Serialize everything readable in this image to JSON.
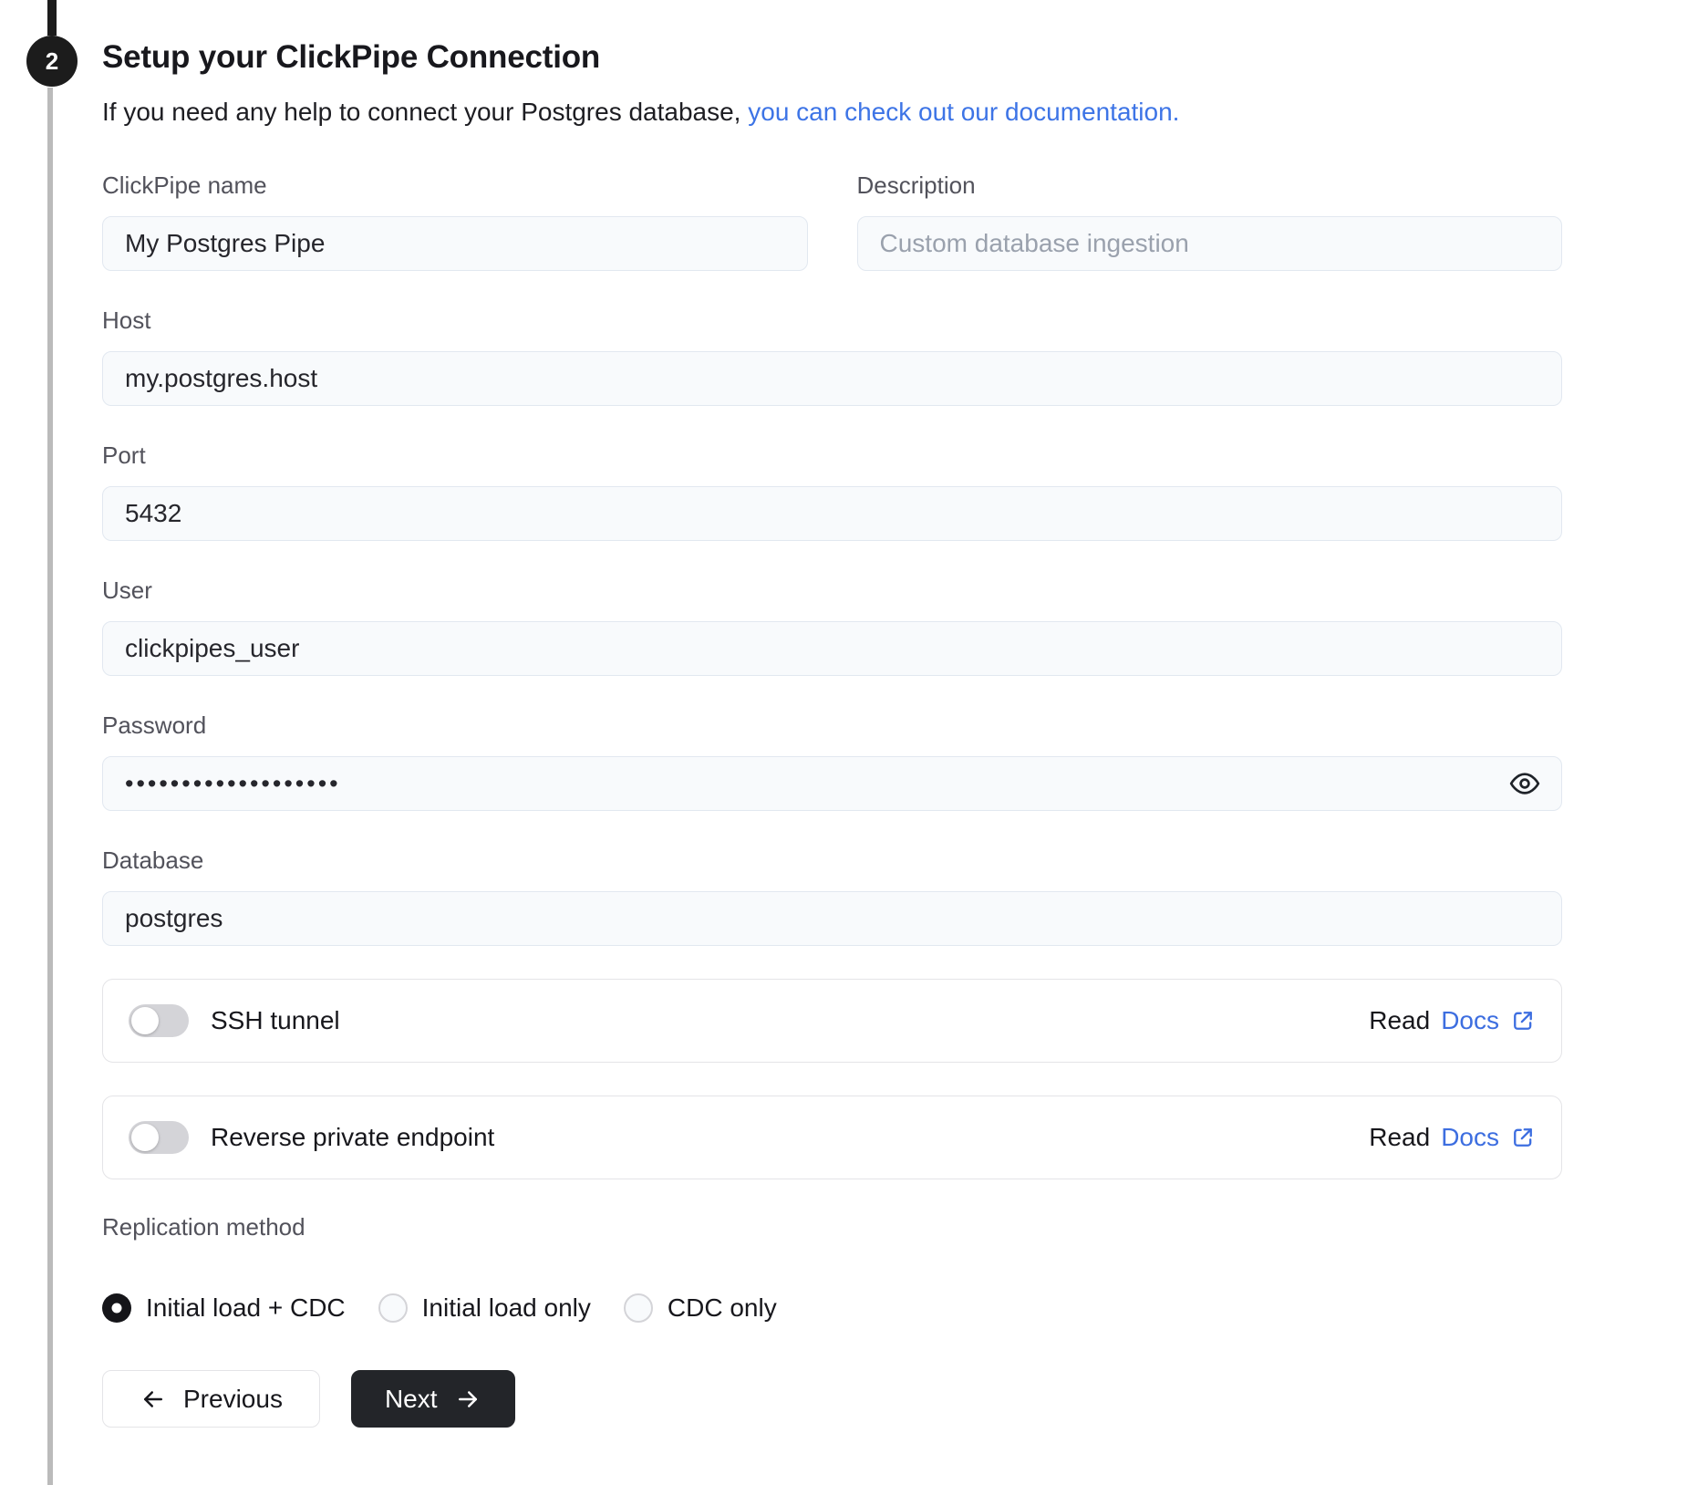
{
  "step": {
    "number": "2"
  },
  "header": {
    "title": "Setup your ClickPipe Connection",
    "subtitle_text": "If you need any help to connect your Postgres database,",
    "subtitle_link": "you can check out our documentation."
  },
  "form": {
    "clickpipe_name": {
      "label": "ClickPipe name",
      "value": "My Postgres Pipe"
    },
    "description": {
      "label": "Description",
      "placeholder": "Custom database ingestion"
    },
    "host": {
      "label": "Host",
      "value": "my.postgres.host"
    },
    "port": {
      "label": "Port",
      "value": "5432"
    },
    "user": {
      "label": "User",
      "value": "clickpipes_user"
    },
    "password": {
      "label": "Password",
      "value": "•••••••••••••••••••",
      "masked": true
    },
    "database": {
      "label": "Database",
      "value": "postgres"
    }
  },
  "toggle_rows": [
    {
      "label": "SSH tunnel",
      "enabled": false,
      "read_text": "Read",
      "docs_text": "Docs"
    },
    {
      "label": "Reverse private endpoint",
      "enabled": false,
      "read_text": "Read",
      "docs_text": "Docs"
    }
  ],
  "replication": {
    "label": "Replication method",
    "options": [
      {
        "label": "Initial load + CDC",
        "selected": true
      },
      {
        "label": "Initial load only",
        "selected": false
      },
      {
        "label": "CDC only",
        "selected": false
      }
    ]
  },
  "actions": {
    "previous_label": "Previous",
    "next_label": "Next"
  },
  "icons": [
    "step-badge",
    "eye-icon",
    "external-link-icon",
    "arrow-left-icon",
    "arrow-right-icon",
    "toggle-knob"
  ],
  "colors": {
    "accent_blue": "#3D6EE0",
    "step_black": "#1C1C1C",
    "connector_gray": "#BBBBBB",
    "input_bg": "#F8FAFC",
    "input_border": "#E2E8F0",
    "label_gray": "#52525B",
    "toggle_off": "#D4D4D8",
    "next_button_bg": "#232529",
    "radio_selected": "#151519"
  }
}
